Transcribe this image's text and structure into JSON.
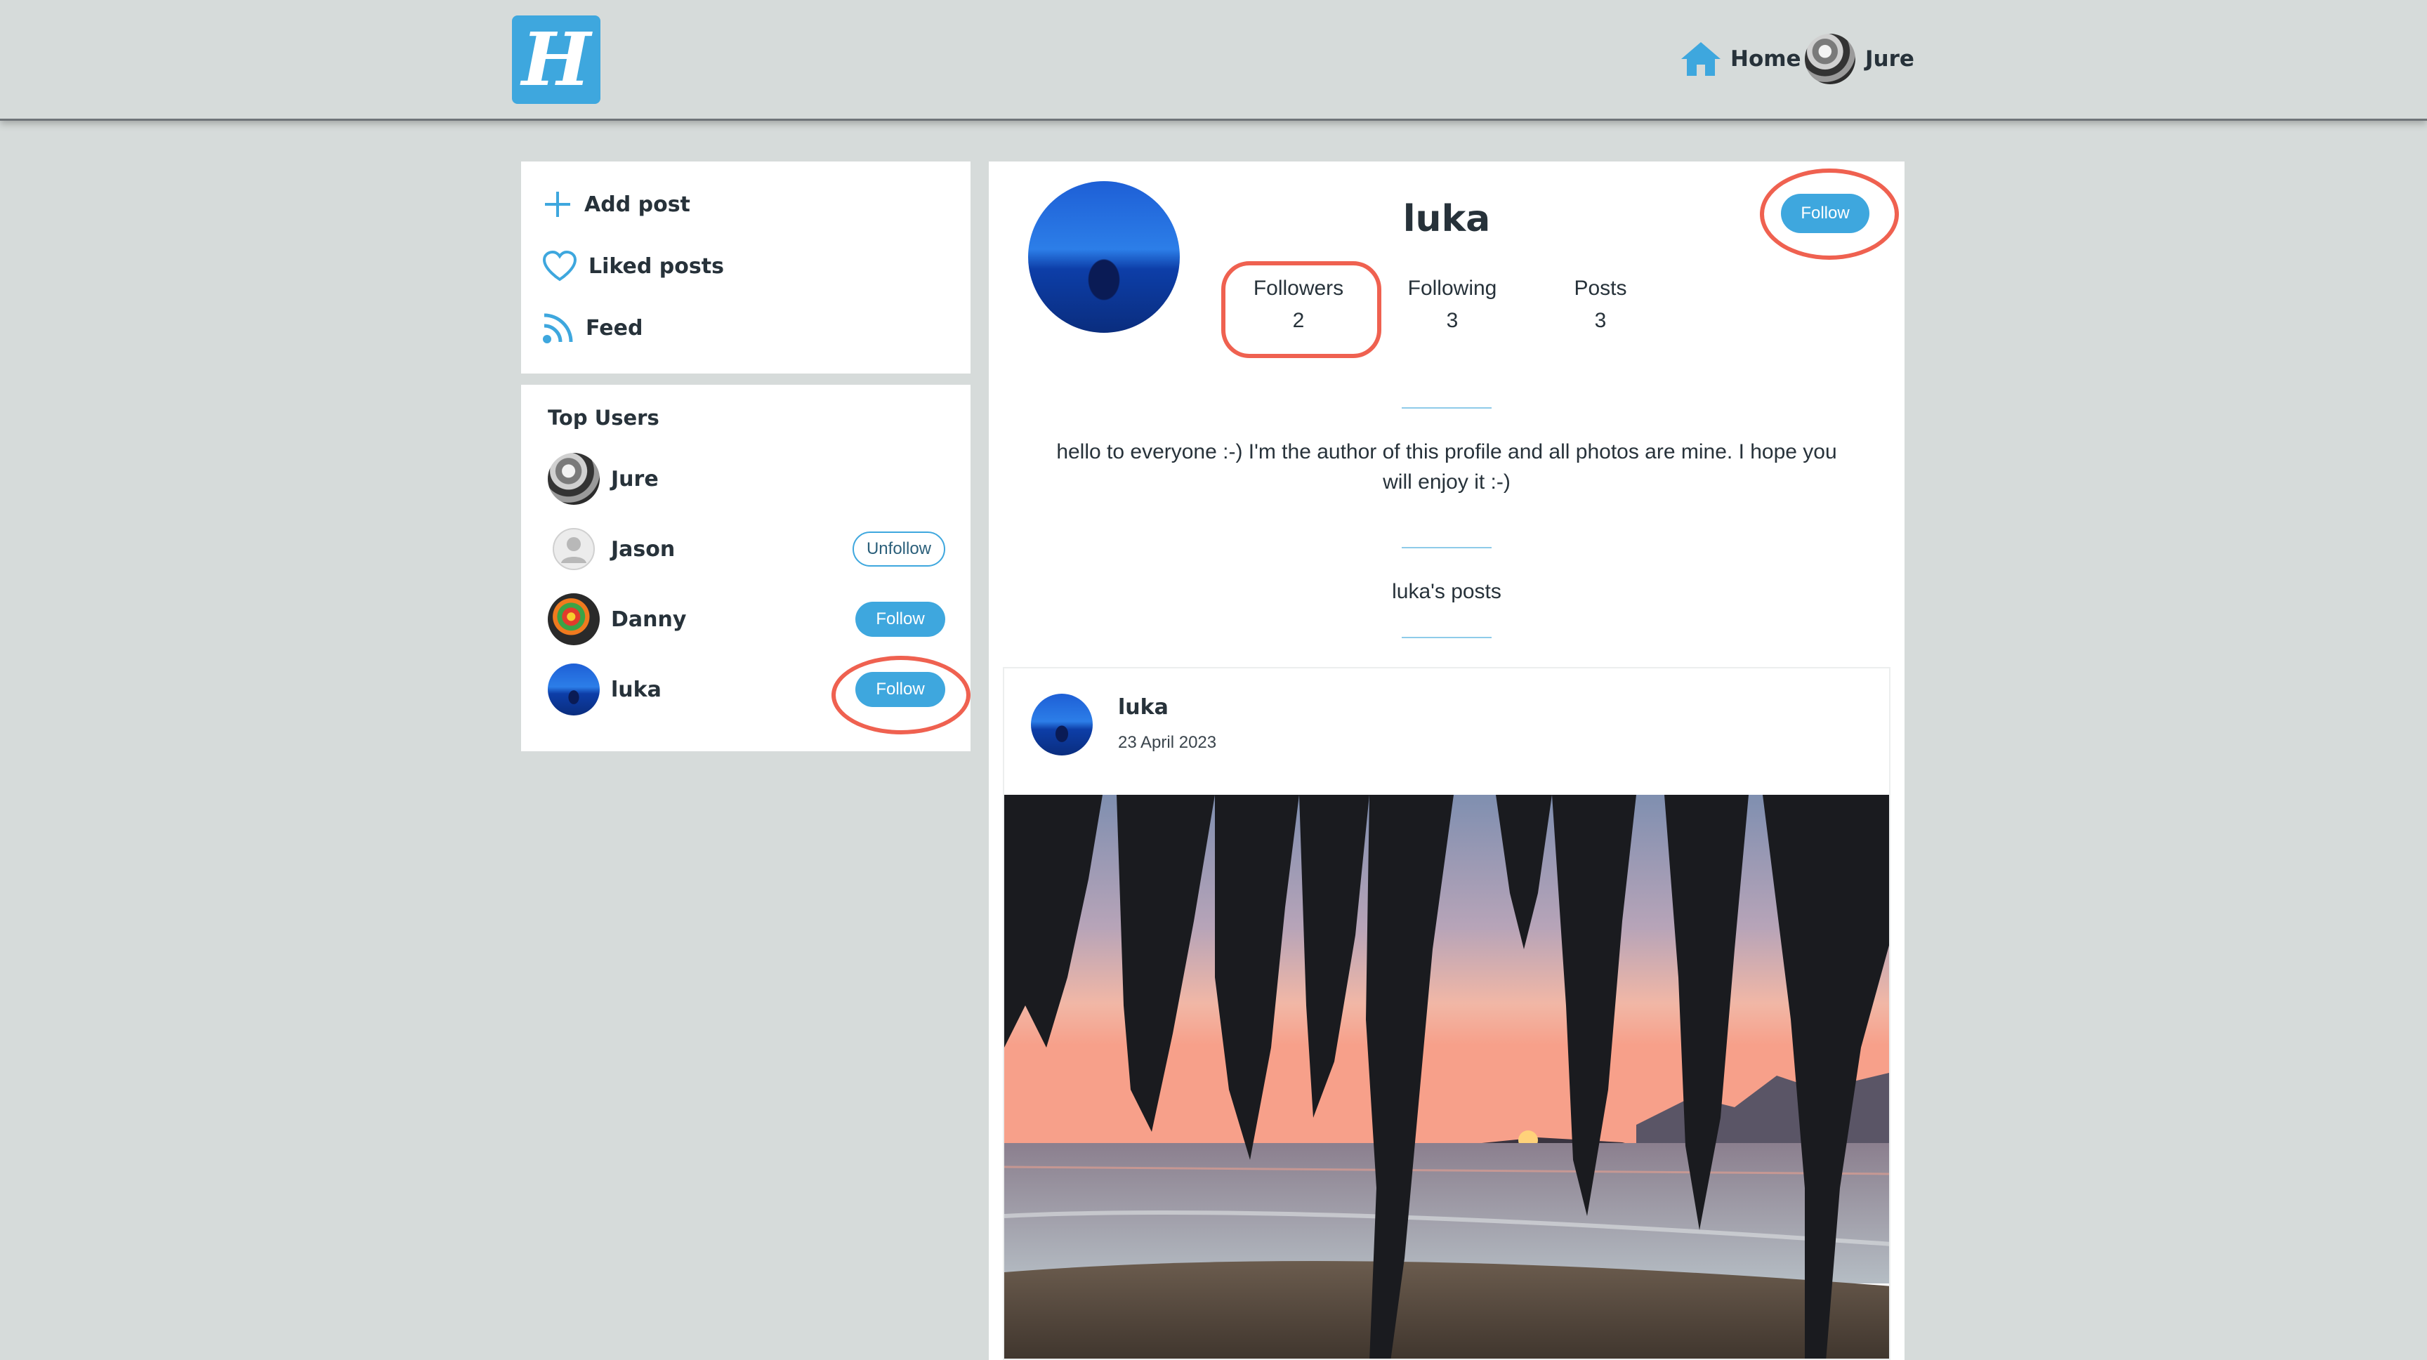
{
  "header": {
    "logo_letter": "H",
    "nav": {
      "home_label": "Home",
      "user_label": "Jure"
    }
  },
  "sidebar": {
    "menu": [
      {
        "label": "Add post",
        "icon": "plus-icon"
      },
      {
        "label": "Liked posts",
        "icon": "heart-icon"
      },
      {
        "label": "Feed",
        "icon": "rss-icon"
      }
    ],
    "top_users": {
      "title": "Top Users",
      "users": [
        {
          "name": "Jure",
          "action": ""
        },
        {
          "name": "Jason",
          "action": "Unfollow"
        },
        {
          "name": "Danny",
          "action": "Follow"
        },
        {
          "name": "luka",
          "action": "Follow"
        }
      ]
    }
  },
  "profile": {
    "name": "luka",
    "follow_label": "Follow",
    "stats": [
      {
        "label": "Followers",
        "value": "2"
      },
      {
        "label": "Following",
        "value": "3"
      },
      {
        "label": "Posts",
        "value": "3"
      }
    ],
    "bio": "hello to everyone :-) I'm the author of this profile and all photos are mine. I hope you will enjoy it :-)",
    "posts_title": "luka's posts"
  },
  "post": {
    "author": "luka",
    "date": "23 April 2023"
  },
  "colors": {
    "accent": "#3ea7de",
    "annotation": "#ef6150",
    "background": "#d6dbda"
  }
}
